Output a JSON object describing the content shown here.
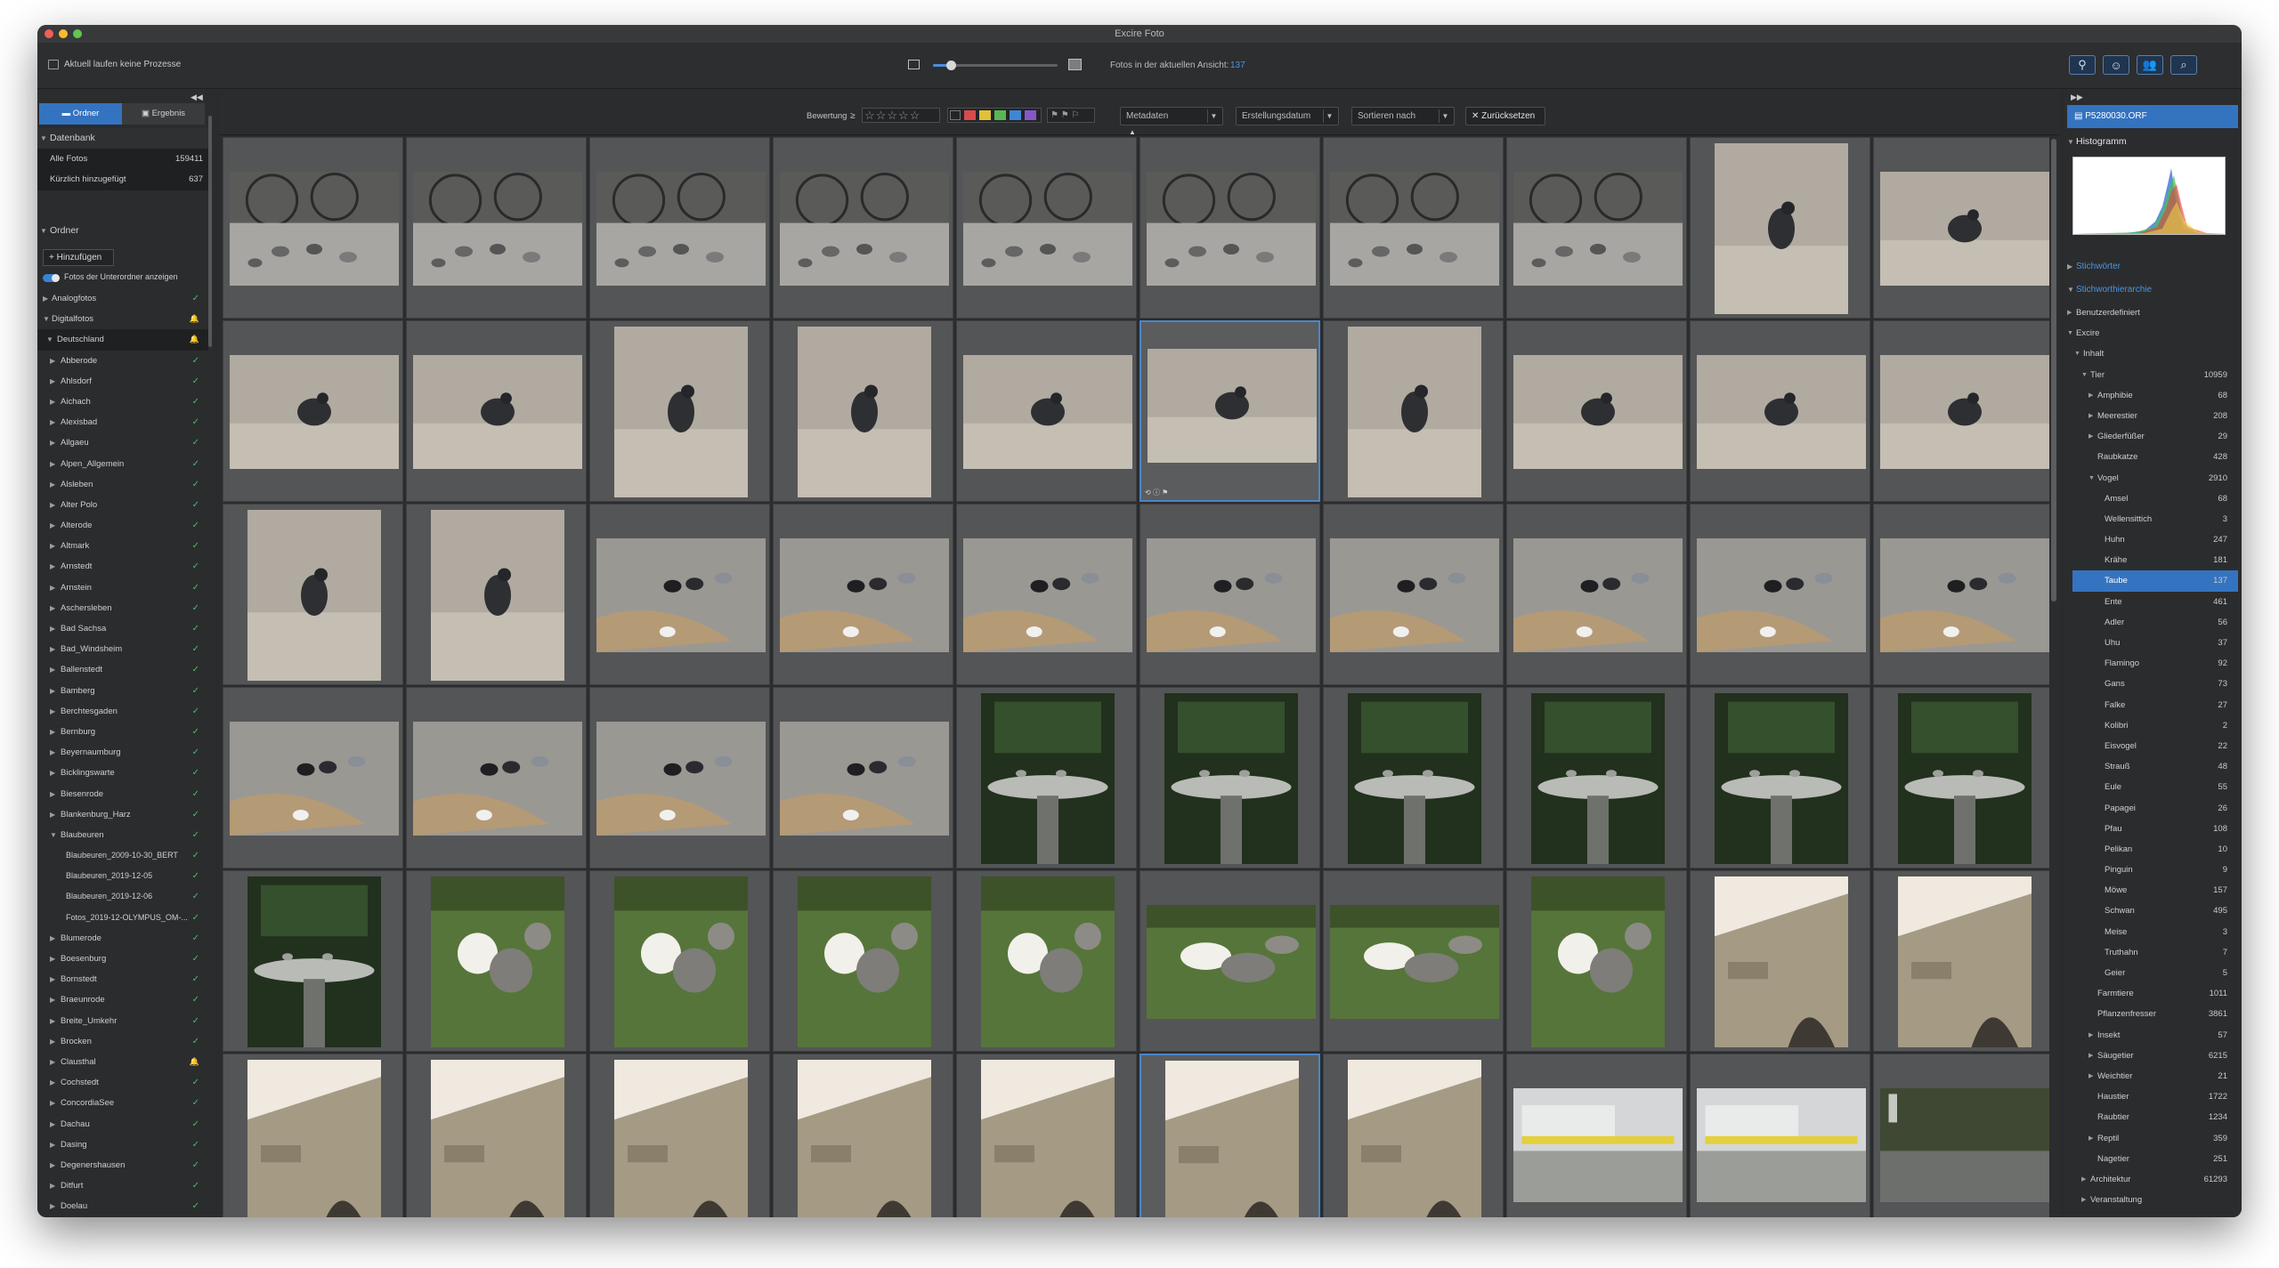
{
  "window": {
    "title": "Excire Foto"
  },
  "toolbar": {
    "process_status": "Aktuell laufen keine Prozesse",
    "photos_label": "Fotos in der aktuellen Ansicht:",
    "photos_count": "137",
    "zoom_level": 0.14
  },
  "sidebar": {
    "tab_folders": "Ordner",
    "tab_results": "Ergebnis",
    "section_database": "Datenbank",
    "all_photos_label": "Alle Fotos",
    "all_photos_count": "159411",
    "recent_label": "Kürzlich hinzugefügt",
    "recent_count": "637",
    "section_folders": "Ordner",
    "add_button": "Hinzufügen",
    "subfolder_toggle": "Fotos der Unterordner anzeigen",
    "analog": "Analogfotos",
    "digital": "Digitalfotos",
    "germany": "Deutschland",
    "cities": [
      "Abberode",
      "Ahlsdorf",
      "Aichach",
      "Alexisbad",
      "Allgaeu",
      "Alpen_Allgemein",
      "Alsleben",
      "Alter Polo",
      "Alterode",
      "Altmark",
      "Arnstedt",
      "Arnstein",
      "Aschersleben",
      "Bad Sachsa",
      "Bad_Windsheim",
      "Ballenstedt",
      "Bamberg",
      "Berchtesgaden",
      "Bernburg",
      "Beyernaumburg",
      "Bicklingswarte",
      "Biesenrode",
      "Blankenburg_Harz",
      "Blaubeuren"
    ],
    "blaubeuren_sub": [
      "Blaubeuren_2009-10-30_BERT",
      "Blaubeuren_2019-12-05",
      "Blaubeuren_2019-12-06",
      "Fotos_2019-12-OLYMPUS_OM-..."
    ],
    "cities_after": [
      "Blumerode",
      "Boesenburg",
      "Bornstedt",
      "Braeunrode",
      "Breite_Umkehr",
      "Brocken",
      "Clausthal",
      "Cochstedt",
      "ConcordiaSee",
      "Dachau",
      "Dasing",
      "Degenershausen",
      "Ditfurt",
      "Doelau"
    ]
  },
  "filterbar": {
    "rating_label": "Bewertung",
    "rating_op": "≥",
    "metadata": "Metadaten",
    "date": "Erstellungsdatum",
    "sort": "Sortieren nach",
    "reset": "Zurücksetzen",
    "color_labels": [
      "#d74b4b",
      "#e0c13a",
      "#59b655",
      "#3f86d6",
      "#8656c9"
    ]
  },
  "rightpanel": {
    "filename": "P5280030.ORF",
    "histogram": "Histogramm",
    "keywords": "Stichwörter",
    "keyword_hierarchy": "Stichworthierarchie",
    "custom": "Benutzerdefiniert",
    "excire": "Excire",
    "content": "Inhalt",
    "animal": "Tier",
    "animal_count": "10959",
    "animal_children": [
      {
        "label": "Amphibie",
        "count": "68"
      },
      {
        "label": "Meerestier",
        "count": "208"
      },
      {
        "label": "Gliederfüßer",
        "count": "29"
      },
      {
        "label": "Raubkatze",
        "count": "428"
      },
      {
        "label": "Vogel",
        "count": "2910"
      }
    ],
    "birds": [
      {
        "label": "Amsel",
        "count": "68"
      },
      {
        "label": "Wellensittich",
        "count": "3"
      },
      {
        "label": "Huhn",
        "count": "247"
      },
      {
        "label": "Krähe",
        "count": "181"
      },
      {
        "label": "Taube",
        "count": "137"
      },
      {
        "label": "Ente",
        "count": "461"
      },
      {
        "label": "Adler",
        "count": "56"
      },
      {
        "label": "Uhu",
        "count": "37"
      },
      {
        "label": "Flamingo",
        "count": "92"
      },
      {
        "label": "Gans",
        "count": "73"
      },
      {
        "label": "Falke",
        "count": "27"
      },
      {
        "label": "Kolibri",
        "count": "2"
      },
      {
        "label": "Eisvogel",
        "count": "22"
      },
      {
        "label": "Strauß",
        "count": "48"
      },
      {
        "label": "Eule",
        "count": "55"
      },
      {
        "label": "Papagei",
        "count": "26"
      },
      {
        "label": "Pfau",
        "count": "108"
      },
      {
        "label": "Pelikan",
        "count": "10"
      },
      {
        "label": "Pinguin",
        "count": "9"
      },
      {
        "label": "Möwe",
        "count": "157"
      },
      {
        "label": "Schwan",
        "count": "495"
      },
      {
        "label": "Meise",
        "count": "3"
      },
      {
        "label": "Truthahn",
        "count": "7"
      },
      {
        "label": "Geier",
        "count": "5"
      }
    ],
    "after_birds": [
      {
        "label": "Farmtiere",
        "count": "1011"
      },
      {
        "label": "Pflanzenfresser",
        "count": "3861"
      },
      {
        "label": "Insekt",
        "count": "57"
      },
      {
        "label": "Säugetier",
        "count": "6215"
      },
      {
        "label": "Weichtier",
        "count": "21"
      },
      {
        "label": "Haustier",
        "count": "1722"
      },
      {
        "label": "Raubtier",
        "count": "1234"
      },
      {
        "label": "Reptil",
        "count": "359"
      },
      {
        "label": "Nagetier",
        "count": "251"
      }
    ],
    "architecture": "Architektur",
    "architecture_count": "61293",
    "event": "Veranstaltung"
  },
  "thumbnails": [
    [
      "pigeons-bikes",
      "pigeons-bikes",
      "pigeons-bikes",
      "pigeons-bikes",
      "pigeons-bikes",
      "pigeons-bikes",
      "pigeons-bikes",
      "pigeons-bikes",
      "pigeon-gravel-portrait",
      "pigeon-gravel"
    ],
    [
      "pigeon-gravel",
      "pigeon-gravel",
      "pigeon-gravel-portrait",
      "pigeon-gravel-portrait",
      "pigeon-gravel",
      "pigeon-gravel-selected",
      "pigeon-gravel-portrait",
      "pigeon-gravel",
      "pigeon-gravel",
      "pigeon-gravel"
    ],
    [
      "pigeon-gravel-portrait",
      "pigeon-gravel-portrait",
      "pigeons-feeding",
      "pigeons-feeding",
      "pigeons-feeding",
      "pigeons-feeding",
      "pigeons-feeding",
      "pigeons-feeding",
      "pigeons-feeding",
      "pigeons-feeding"
    ],
    [
      "pigeons-feeding",
      "pigeons-feeding",
      "pigeons-feeding",
      "pigeons-feeding",
      "fountain",
      "fountain",
      "fountain",
      "fountain",
      "fountain",
      "fountain"
    ],
    [
      "fountain",
      "geese",
      "geese",
      "geese",
      "geese",
      "geese-landscape",
      "geese-landscape",
      "geese",
      "arch",
      "arch"
    ],
    [
      "arch",
      "arch",
      "arch",
      "arch",
      "arch",
      "arch",
      "arch",
      "building",
      "building",
      "garden"
    ]
  ]
}
